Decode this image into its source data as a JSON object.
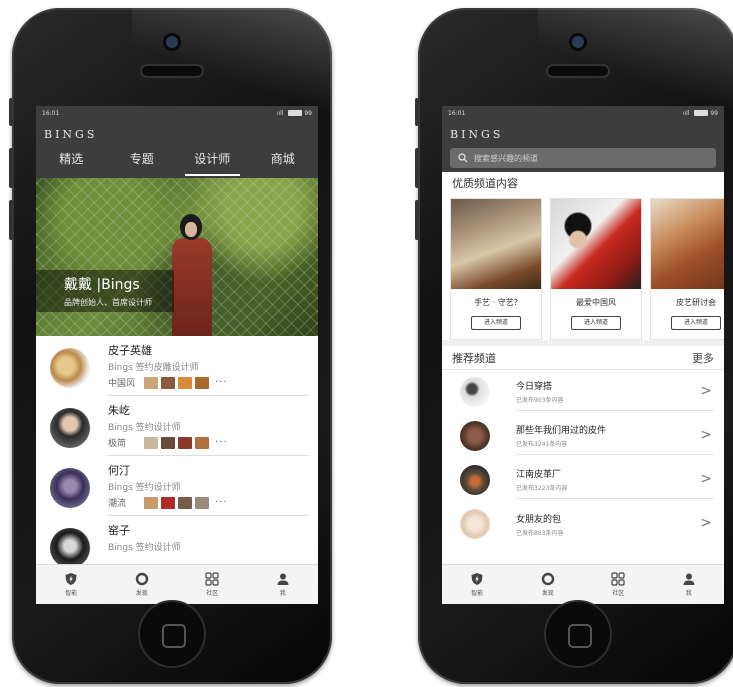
{
  "left": {
    "status": {
      "time": "16:01",
      "signal": "ııll",
      "battery": "99"
    },
    "brand": "BINGS",
    "tabs": [
      {
        "label": "精选"
      },
      {
        "label": "专题"
      },
      {
        "label": "设计师"
      },
      {
        "label": "商城"
      }
    ],
    "hero": {
      "title": "戴戴 |Bings",
      "subtitle": "品牌创始人、首席设计师"
    },
    "designers": [
      {
        "name": "皮子英雄",
        "title": "Bings 签约皮雕设计师",
        "tag": "中国风",
        "more": "···"
      },
      {
        "name": "朱屹",
        "title": "Bings 签约设计师",
        "tag": "极简",
        "more": "···"
      },
      {
        "name": "何汀",
        "title": "Bings 签约设计师",
        "tag": "潮流",
        "more": "···"
      },
      {
        "name": "窑子",
        "title": "Bings 签约设计师",
        "tag": "",
        "more": ""
      }
    ],
    "nav": [
      {
        "label": "智能",
        "icon": "shield-bolt-icon"
      },
      {
        "label": "发现",
        "icon": "ring-icon"
      },
      {
        "label": "社区",
        "icon": "grid-icon"
      },
      {
        "label": "我",
        "icon": "user-icon"
      }
    ]
  },
  "right": {
    "status": {
      "time": "16:01",
      "signal": "ııll",
      "battery": "99"
    },
    "brand": "BINGS",
    "search": {
      "placeholder": "搜索感兴趣的频道"
    },
    "featured": {
      "title": "优质频道内容",
      "cards": [
        {
          "title": "手艺 · 守艺?",
          "button": "进入频道"
        },
        {
          "title": "最爱中国风",
          "button": "进入频道"
        },
        {
          "title": "皮艺研讨会",
          "button": "进入频道"
        }
      ]
    },
    "recommended": {
      "title": "推荐频道",
      "more": "更多",
      "items": [
        {
          "name": "今日穿搭",
          "count": "已发布903条内容"
        },
        {
          "name": "那些年我们用过的皮件",
          "count": "已发布3241条内容"
        },
        {
          "name": "江南皮革厂",
          "count": "已发布3223条内容"
        },
        {
          "name": "女朋友的包",
          "count": "已发布863条内容"
        }
      ]
    },
    "nav": [
      {
        "label": "智能",
        "icon": "shield-bolt-icon"
      },
      {
        "label": "发现",
        "icon": "ring-icon"
      },
      {
        "label": "社区",
        "icon": "grid-icon"
      },
      {
        "label": "我",
        "icon": "user-icon"
      }
    ]
  },
  "colors": {
    "header": "#3d3d3d",
    "tab_active_underline": "#ffffff",
    "nav_bg": "#f4f4f4"
  }
}
